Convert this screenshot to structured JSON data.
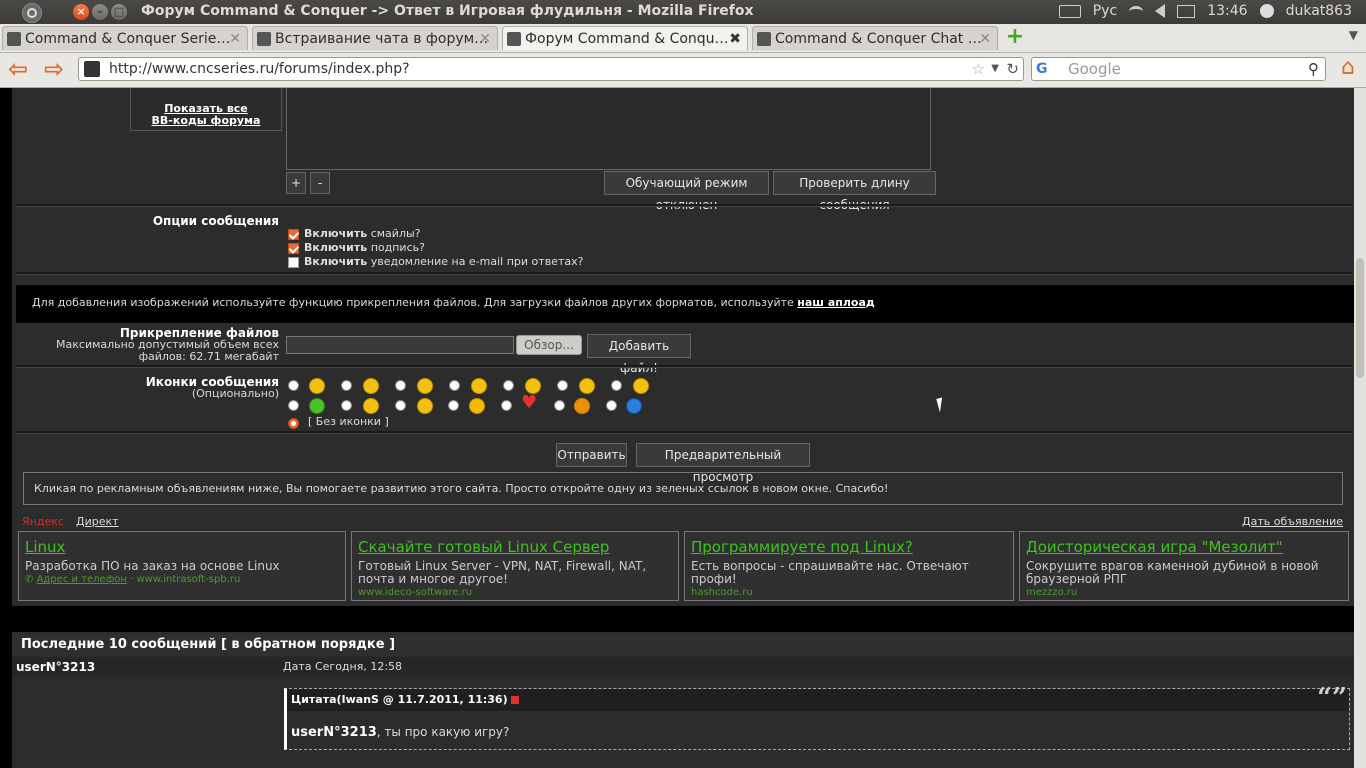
{
  "system": {
    "window_title": "Форум Command & Conquer -> Ответ в Игровая флудильня - Mozilla Firefox",
    "keyboard_layout": "Рус",
    "clock": "13:46",
    "user": "dukat863"
  },
  "browser": {
    "tabs": [
      {
        "label": "Command & Conquer Serie…"
      },
      {
        "label": "Встраивание чата в форум…"
      },
      {
        "label": "Форум Command & Conqu…",
        "active": true
      },
      {
        "label": "Command & Conquer Chat …"
      }
    ],
    "url": "http://www.cncseries.ru/forums/index.php?",
    "search_placeholder": "Google"
  },
  "editor": {
    "bbcode_link_line1": "Показать все",
    "bbcode_link_line2": "BB-коды форума",
    "plus_label": "+",
    "minus_label": "-",
    "learning_mode_label": "Обучающий режим отключен",
    "check_length_label": "Проверить длину сообщения"
  },
  "options": {
    "title": "Опции сообщения",
    "items": [
      {
        "bold": "Включить",
        "rest": "смайлы?",
        "checked": true
      },
      {
        "bold": "Включить",
        "rest": "подпись?",
        "checked": true
      },
      {
        "bold": "Включить",
        "rest": "уведомление на e-mail при ответах?",
        "checked": false
      }
    ]
  },
  "upload_notice": {
    "text": "Для добавления изображений используйте функцию прикрепления файлов. Для загрузки файлов других форматов, используйте",
    "link": "наш аплоад"
  },
  "attachments": {
    "title": "Прикрепление файлов",
    "desc_line1": "Максимально допустимый объем всех",
    "desc_line2": "файлов: 62.71 мегабайт",
    "browse_label": "Обзор...",
    "add_label": "Добавить файл!"
  },
  "post_icons": {
    "title": "Иконки сообщения",
    "subtitle": "(Опционально)",
    "none_label": "[ Без иконки ]"
  },
  "actions": {
    "submit_label": "Отправить",
    "preview_label": "Предварительный просмотр"
  },
  "ads": {
    "notice": "Кликая по рекламным объявлениям ниже, Вы помогаете развитию этого сайта. Просто откройте одну из зеленых ссылок в новом окне. Спасибо!",
    "yandex": "Яндекс",
    "direct": "Директ",
    "place_ad": "Дать объявление",
    "items": [
      {
        "title": "Linux",
        "text": "Разработка ПО на заказ на основе Linux",
        "extra": "Адрес и телефон",
        "url": "www.intrasoft-spb.ru"
      },
      {
        "title": "Скачайте готовый Linux Сервер",
        "text": "Готовый Linux Server - VPN, NAT, Firewall, NAT, почта и многое другое!",
        "url": "www.ideco-software.ru"
      },
      {
        "title": "Программируете под Linux?",
        "text": "Есть вопросы - спрашивайте нас. Отвечают профи!",
        "url": "hashcode.ru"
      },
      {
        "title": "Доисторическая игра \"Мезолит\"",
        "text": "Сокрушите врагов каменной дубиной в новой браузерной РПГ",
        "url": "mezzzo.ru"
      }
    ]
  },
  "recent": {
    "header": "Последние 10 сообщений [ в обратном порядке ]",
    "author": "userN°3213",
    "date": "Дата Сегодня, 12:58",
    "quote_header": "Цитата(IwanS @ 11.7.2011, 11:36)",
    "quote_user": "userN°3213",
    "quote_text": ", ты про какую игру?"
  }
}
